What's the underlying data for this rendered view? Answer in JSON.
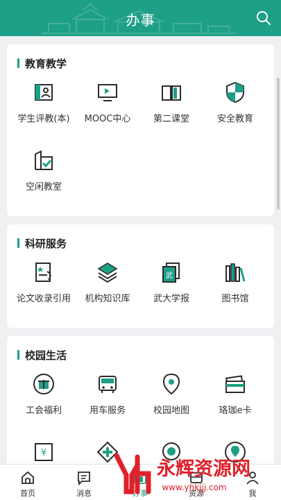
{
  "header": {
    "title": "办事",
    "search_icon": "search-icon"
  },
  "sections": [
    {
      "title": "教育教学",
      "items": [
        {
          "label": "学生评教(本)",
          "icon": "student-evaluation-icon"
        },
        {
          "label": "MOOC中心",
          "icon": "video-screen-icon"
        },
        {
          "label": "第二课堂",
          "icon": "open-book-icon"
        },
        {
          "label": "安全教育",
          "icon": "shield-icon"
        },
        {
          "label": "空闲教室",
          "icon": "building-check-icon"
        }
      ]
    },
    {
      "title": "科研服务",
      "items": [
        {
          "label": "论文收录引用",
          "icon": "paper-star-icon"
        },
        {
          "label": "机构知识库",
          "icon": "layers-icon"
        },
        {
          "label": "武大学报",
          "icon": "journal-icon"
        },
        {
          "label": "图书馆",
          "icon": "library-books-icon"
        }
      ]
    },
    {
      "title": "校园生活",
      "items": [
        {
          "label": "工会福利",
          "icon": "gift-icon"
        },
        {
          "label": "用车服务",
          "icon": "bus-icon"
        },
        {
          "label": "校园地图",
          "icon": "map-pin-icon"
        },
        {
          "label": "珞珈e卡",
          "icon": "card-icon"
        },
        {
          "label": "",
          "icon": "yen-wallet-icon"
        },
        {
          "label": "",
          "icon": "medical-cross-icon"
        },
        {
          "label": "",
          "icon": "badge-icon"
        },
        {
          "label": "",
          "icon": "location-user-icon"
        }
      ]
    }
  ],
  "tabbar": [
    {
      "label": "首页",
      "icon": "home-icon"
    },
    {
      "label": "消息",
      "icon": "message-icon"
    },
    {
      "label": "办事",
      "icon": "service-icon",
      "active": true
    },
    {
      "label": "资源",
      "icon": "resource-icon"
    },
    {
      "label": "我",
      "icon": "user-icon"
    }
  ],
  "watermark": {
    "text": "永辉资源网",
    "url": "www.yhkjjj.com"
  },
  "colors": {
    "primary": "#1e9f87",
    "background": "#eef0f2"
  }
}
